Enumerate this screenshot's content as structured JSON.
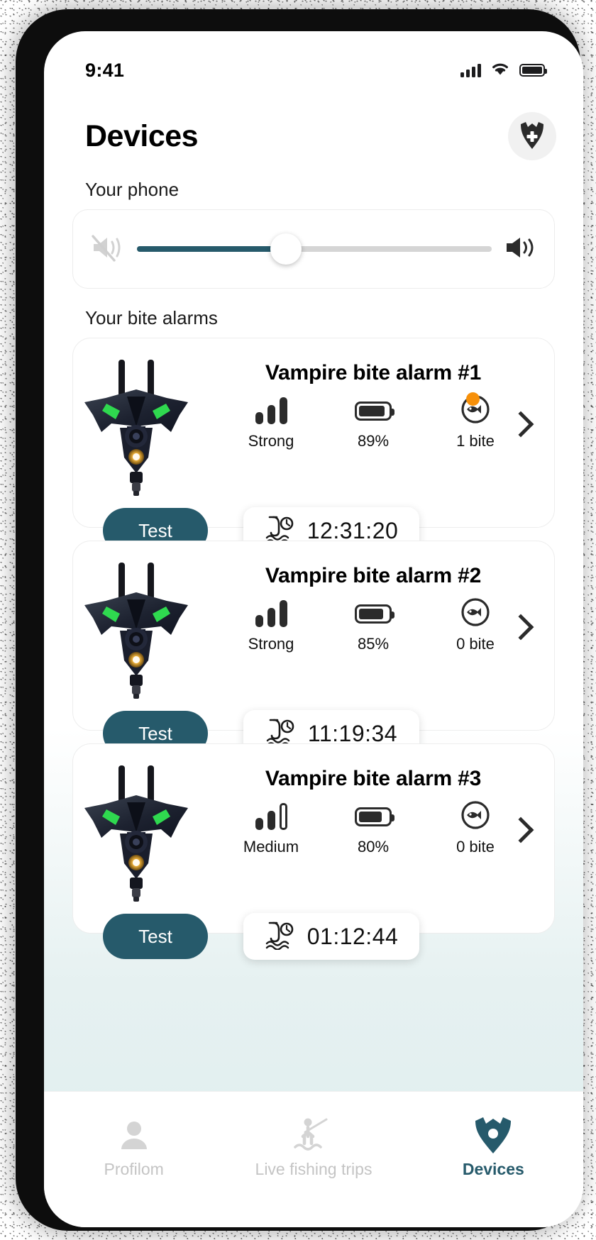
{
  "status_bar": {
    "time": "9:41",
    "signal_icon": "cellular-signal-icon",
    "wifi_icon": "wifi-icon",
    "battery_icon": "battery-icon"
  },
  "header": {
    "title": "Devices",
    "add_device_icon": "bat-plus-icon"
  },
  "phone_section": {
    "label": "Your phone",
    "mute_icon": "volume-mute-icon",
    "speaker_icon": "volume-high-icon",
    "volume_percent": 42
  },
  "alarms_section": {
    "label": "Your bite alarms"
  },
  "colors": {
    "accent": "#265a6b",
    "badge": "#f79009",
    "track": "#d5d5d5",
    "page_tint": "#e1eff0"
  },
  "devices": [
    {
      "name": "Vampire bite alarm #1",
      "signal_label": "Strong",
      "signal_level": 3,
      "battery_label": "89%",
      "battery_percent": 89,
      "bites_label": "1 bite",
      "has_bite_badge": true,
      "timer": "12:31:20",
      "test_label": "Test",
      "chevron_icon": "chevron-right-icon",
      "signal_icon": "signal-bars-icon",
      "battery_icon": "battery-icon",
      "fish_icon": "fish-circle-icon",
      "timer_icon": "fishing-rod-clock-icon",
      "device_image": "vampire-bite-alarm-image"
    },
    {
      "name": "Vampire bite alarm #2",
      "signal_label": "Strong",
      "signal_level": 3,
      "battery_label": "85%",
      "battery_percent": 85,
      "bites_label": "0 bite",
      "has_bite_badge": false,
      "timer": "11:19:34",
      "test_label": "Test",
      "chevron_icon": "chevron-right-icon",
      "signal_icon": "signal-bars-icon",
      "battery_icon": "battery-icon",
      "fish_icon": "fish-circle-icon",
      "timer_icon": "fishing-rod-clock-icon",
      "device_image": "vampire-bite-alarm-image"
    },
    {
      "name": "Vampire bite alarm #3",
      "signal_label": "Medium",
      "signal_level": 2,
      "battery_label": "80%",
      "battery_percent": 80,
      "bites_label": "0 bite",
      "has_bite_badge": false,
      "timer": "01:12:44",
      "test_label": "Test",
      "chevron_icon": "chevron-right-icon",
      "signal_icon": "signal-bars-icon",
      "battery_icon": "battery-icon",
      "fish_icon": "fish-circle-icon",
      "timer_icon": "fishing-rod-clock-icon",
      "device_image": "vampire-bite-alarm-image"
    }
  ],
  "tabbar": {
    "items": [
      {
        "label": "Profilom",
        "icon": "person-icon",
        "active": false
      },
      {
        "label": "Live fishing trips",
        "icon": "fisherman-icon",
        "active": false
      },
      {
        "label": "Devices",
        "icon": "bat-device-icon",
        "active": true
      }
    ]
  }
}
